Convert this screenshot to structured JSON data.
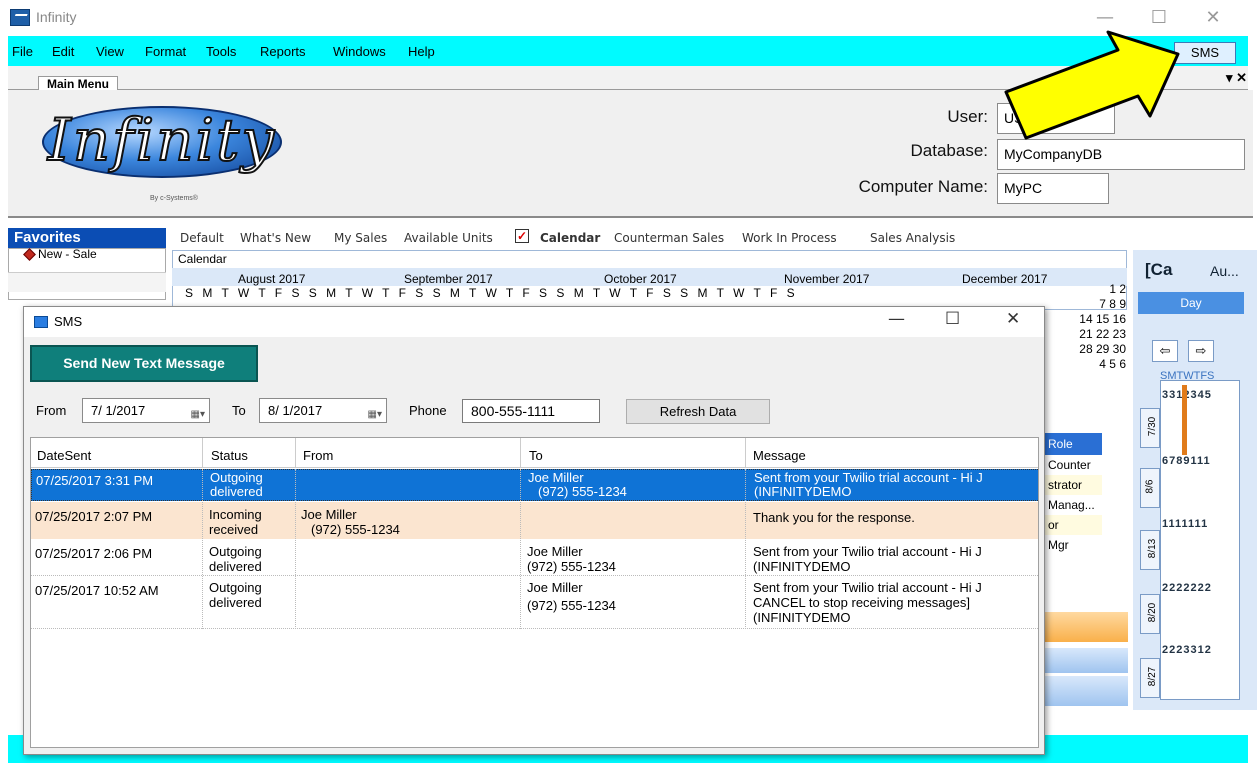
{
  "app": {
    "title": "Infinity"
  },
  "window_controls": {
    "minimize": "—",
    "maximize": "☐",
    "close": "✕"
  },
  "menu": {
    "items": [
      "File",
      "Edit",
      "View",
      "Format",
      "Tools",
      "Reports",
      "Windows",
      "Help"
    ],
    "sms_button": "SMS"
  },
  "tabs": {
    "main": "Main Menu",
    "controls": "▾ ✕"
  },
  "header": {
    "logo_text": "Infinity",
    "logo_sub": "By c-Systems®",
    "user_label": "User:",
    "user_value": "USR",
    "database_label": "Database:",
    "database_value": "MyCompanyDB",
    "computer_label": "Computer Name:",
    "computer_value": "MyPC"
  },
  "favorites": {
    "title": "Favorites",
    "item": "New - Sale"
  },
  "dashboard": {
    "tabs": [
      "Default",
      "What's New",
      "My Sales",
      "Available Units",
      "Calendar",
      "Counterman Sales",
      "Work In Process",
      "Sales Analysis"
    ],
    "calendar_label": "Calendar",
    "months": [
      "August 2017",
      "September 2017",
      "October 2017",
      "November 2017",
      "December 2017"
    ],
    "dow": "S M T W T F S"
  },
  "background_right": {
    "day_numbers": [
      "1  2",
      "7  8  9",
      "14 15 16",
      "21 22 23",
      "28 29 30",
      "4  5  6"
    ],
    "role_header": "Role",
    "roles": [
      "Counter",
      "strator",
      "Manag...",
      "or",
      "Mgr"
    ],
    "calendar_title": "[Ca",
    "calendar_sub": "Au...",
    "day_button": "Day",
    "week_labels": [
      "7/30",
      "8/6",
      "8/13",
      "8/20",
      "8/27"
    ],
    "week_numbers": [
      "6789111",
      "1111111",
      "2222222",
      "2223312"
    ],
    "dow_small": "SMTWTFS",
    "top_nums": "3312345"
  },
  "sms": {
    "title": "SMS",
    "send_button": "Send New Text Message",
    "from_label": "From",
    "from_date": "7/ 1/2017",
    "to_label": "To",
    "to_date": "8/ 1/2017",
    "phone_label": "Phone",
    "phone_value": "800-555-1111",
    "refresh_button": "Refresh Data",
    "columns": [
      "DateSent",
      "Status",
      "From",
      "To",
      "Message"
    ],
    "rows": [
      {
        "date": "07/25/2017 3:31 PM",
        "status1": "Outgoing",
        "status2": "delivered",
        "from1": "",
        "from2": "",
        "to1": "Joe Miller",
        "to2": "(972) 555-1234",
        "msg1": "Sent from your Twilio trial account - Hi J",
        "msg2": "(INFINITYDEMO",
        "msg3": ""
      },
      {
        "date": "07/25/2017 2:07 PM",
        "status1": "Incoming",
        "status2": "received",
        "from1": "Joe Miller",
        "from2": "(972) 555-1234",
        "to1": "",
        "to2": "",
        "msg1": "Thank you for the response.",
        "msg2": "",
        "msg3": ""
      },
      {
        "date": "07/25/2017 2:06 PM",
        "status1": "Outgoing",
        "status2": "delivered",
        "from1": "",
        "from2": "",
        "to1": "Joe Miller",
        "to2": "(972) 555-1234",
        "msg1": "Sent from your Twilio trial account - Hi J",
        "msg2": "(INFINITYDEMO",
        "msg3": ""
      },
      {
        "date": "07/25/2017 10:52 AM",
        "status1": "Outgoing",
        "status2": "delivered",
        "from1": "",
        "from2": "",
        "to1": "Joe Miller",
        "to2": "(972) 555-1234",
        "msg1": "Sent from your Twilio trial account - Hi J",
        "msg2": "CANCEL to stop receiving messages]",
        "msg3": "(INFINITYDEMO"
      }
    ]
  },
  "icons": {
    "app": "app-logo-icon",
    "sms_window": "sms-window-icon",
    "arrow": "callout-arrow-icon",
    "favorite": "diamond-icon"
  },
  "colors": {
    "menubar": "#00fbff",
    "selected_row": "#0f73d6",
    "incoming_row": "#fbe5d0",
    "send_button": "#0f7f7b",
    "favorites_header": "#0b4db4",
    "arrow_fill": "#ffff00"
  }
}
